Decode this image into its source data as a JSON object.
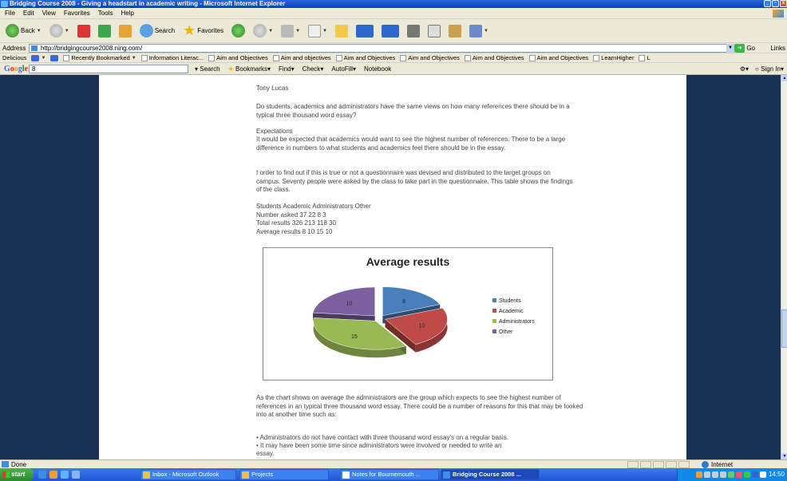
{
  "window": {
    "title": "Bridging Course 2008 - Giving a headstart in academic writing - Microsoft Internet Explorer"
  },
  "menu": [
    "File",
    "Edit",
    "View",
    "Favorites",
    "Tools",
    "Help"
  ],
  "toolbar": {
    "back": "Back",
    "search": "Search",
    "favorites": "Favorites"
  },
  "address": {
    "label": "Address",
    "url": "http://bridgingcourse2008.ning.com/",
    "go": "Go",
    "links": "Links"
  },
  "bookmarks": [
    "Delicious",
    "Recently Bookmarked",
    "Information Literac...",
    "Aim and Objectives",
    "Aim and objectives",
    "Aim and Objectives",
    "Aim and Objectives",
    "Aim and Objectives",
    "Aim and Objectives",
    "LearnHigher",
    "L"
  ],
  "google": {
    "logo": "Google",
    "query": "8",
    "search": "Search",
    "bookmarks": "Bookmarks",
    "find": "Find",
    "check": "Check",
    "autofill": "AutoFill",
    "notebook": "Notebook",
    "signin": "Sign In"
  },
  "article": {
    "author": "Tony Lucas",
    "question": "Do students, academics and administrators have the same views on how many references there should be in a typical three thousand word essay?",
    "expectations_heading": "Expectations",
    "expectations": "It would be expected that academics would want to see the highest number of references. There to be a large difference in numbers to what students and academics feel there should be in the essay.",
    "method": "I order to find out if this is true or not a questionnaire was devised and distributed to the target groups on campus. Seventy people were asked by the class to take part in the questionnaire. This table shows the findings of the class.",
    "table_header": "Students Academic Administrators Other",
    "table_row1": "Number asked 37 22 8 3",
    "table_row2": "Total results 326 213 118 30",
    "table_row3": "Average results 8 10 15 10",
    "conclusion1": "As the chart shows on average the administrators are the group which expects to see the highest number of references in an typical three thousand word essay. There could be a number of reasons for this that may be looked into at another time such as:",
    "bullet1": "• Administrators do not have contact with three thousand word essay's on a regular basis.",
    "bullet2": "• It may have been some time since administrators were involved or needed to write an",
    "bullet2b": "essay."
  },
  "chart_data": {
    "type": "pie",
    "title": "Average results",
    "categories": [
      "Students",
      "Academic",
      "Administrators",
      "Other"
    ],
    "values": [
      8,
      10,
      15,
      10
    ],
    "colors": [
      "#4a7ebb",
      "#be4b48",
      "#98b954",
      "#7d60a0"
    ],
    "legend": "right"
  },
  "status": {
    "text": "Done",
    "zone": "Internet"
  },
  "taskbar": {
    "start": "start",
    "tasks": [
      "Inbox - Microsoft Outlook",
      "Projects",
      "Notes for Bournemouth ...",
      "Bridging Course 2008 ..."
    ],
    "clock": "14:50"
  }
}
